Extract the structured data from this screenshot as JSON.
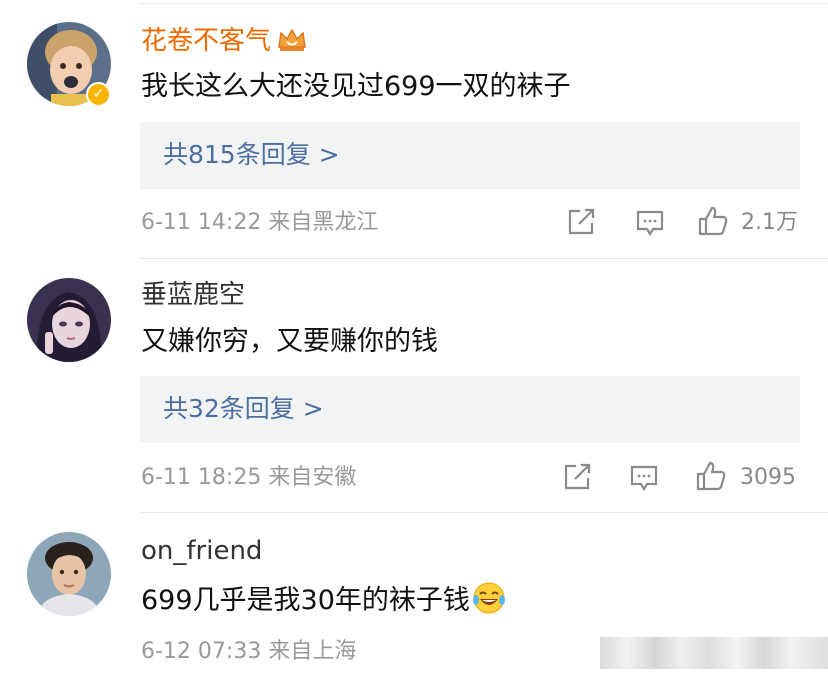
{
  "comments": [
    {
      "username": "花卷不客气",
      "text": "我长这么大还没见过699一双的袜子",
      "replies_label": "共815条回复 >",
      "time": "6-11 14:22",
      "location": "来自黑龙江",
      "likes": "2.1万",
      "verified": true
    },
    {
      "username": "垂蓝鹿空",
      "text": "又嫌你穷，又要赚你的钱",
      "replies_label": "共32条回复 >",
      "time": "6-11 18:25",
      "location": "来自安徽",
      "likes": "3095"
    },
    {
      "username": "on_friend",
      "text": "699几乎是我30年的袜子钱",
      "emoji": "laughing-tears",
      "time": "6-12 07:33",
      "location": "来自上海"
    }
  ],
  "colors": {
    "vip_name": "#f06a00",
    "link": "#4d6e9e",
    "meta": "#999999",
    "reply_bg": "#f2f3f5",
    "verified_badge": "#f7b500"
  },
  "icons": [
    "crown-icon",
    "verified-icon",
    "share-icon",
    "comment-icon",
    "like-icon"
  ]
}
